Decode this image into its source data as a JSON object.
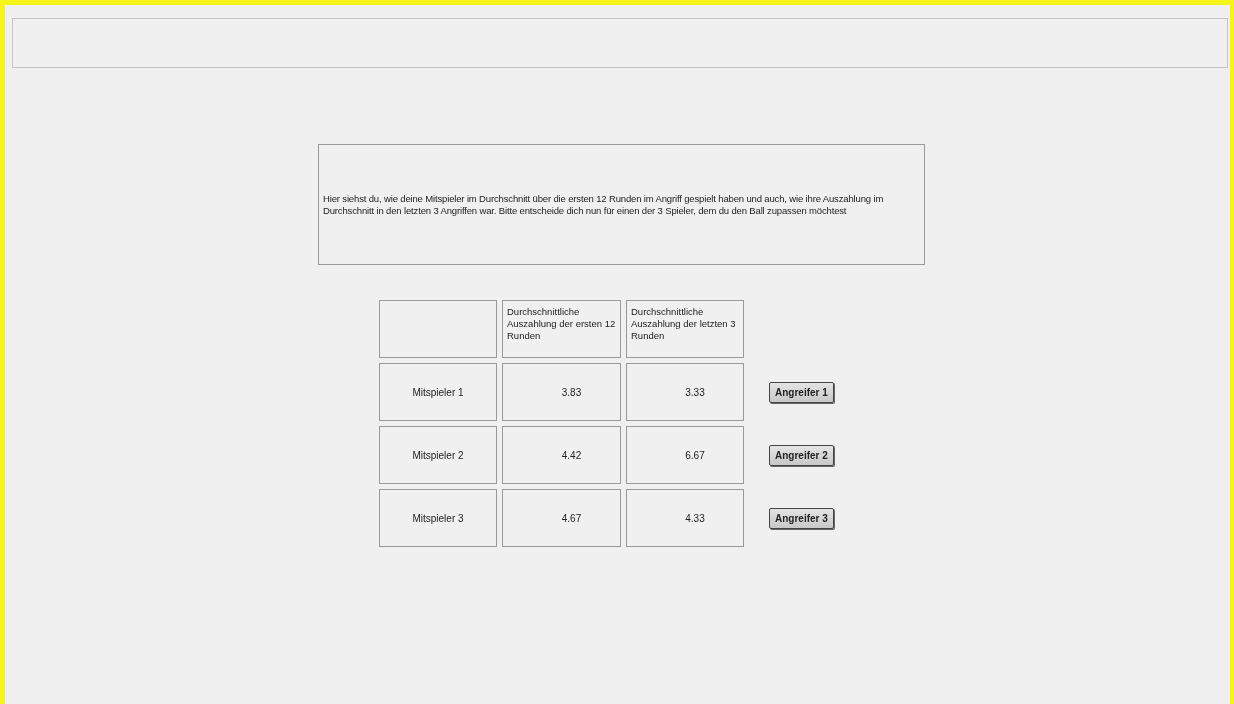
{
  "instruction": "Hier siehst du, wie deine Mitspieler im Durchschnitt über die ersten 12 Runden im Angriff gespielt haben und auch, wie ihre Auszahlung im Durchschnitt in den letzten 3 Angriffen war. Bitte entscheide dich nun für einen der 3 Spieler, dem du den Ball zupassen möchtest",
  "table": {
    "columns": [
      "Durchschnittliche Auszahlung der ersten 12 Runden",
      "Durchschnittliche Auszahlung der letzten 3 Runden"
    ],
    "rows": [
      {
        "player": "Mitspieler 1",
        "first": "3.83",
        "last": "3.33",
        "button": "Angreifer 1"
      },
      {
        "player": "Mitspieler 2",
        "first": "4.42",
        "last": "6.67",
        "button": "Angreifer 2"
      },
      {
        "player": "Mitspieler 3",
        "first": "4.67",
        "last": "4.33",
        "button": "Angreifer 3"
      }
    ]
  }
}
